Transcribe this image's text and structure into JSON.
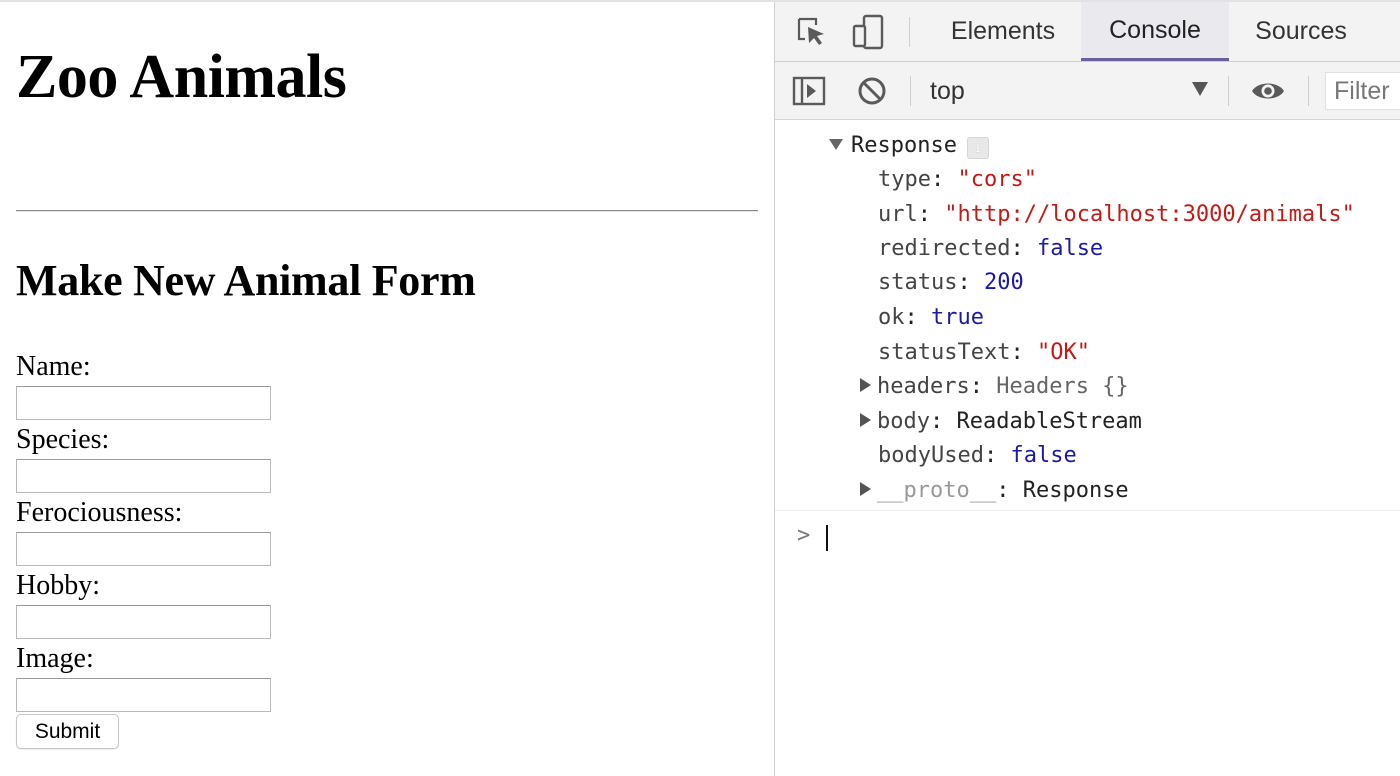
{
  "page": {
    "title": "Zoo Animals",
    "form_title": "Make New Animal Form",
    "fields": [
      {
        "label": "Name:",
        "value": ""
      },
      {
        "label": "Species:",
        "value": ""
      },
      {
        "label": "Ferociousness:",
        "value": ""
      },
      {
        "label": "Hobby:",
        "value": ""
      },
      {
        "label": "Image:",
        "value": ""
      }
    ],
    "submit_label": "Submit"
  },
  "devtools": {
    "tabs": [
      {
        "label": "Elements",
        "active": false
      },
      {
        "label": "Console",
        "active": true
      },
      {
        "label": "Sources",
        "active": false
      }
    ],
    "toolbar": {
      "context": "top",
      "filter_placeholder": "Filter"
    },
    "console": {
      "object_name": "Response",
      "info_badge": "i",
      "properties": [
        {
          "key": "type",
          "value": "\"cors\"",
          "kind": "string"
        },
        {
          "key": "url",
          "value": "\"http://localhost:3000/animals\"",
          "kind": "string"
        },
        {
          "key": "redirected",
          "value": "false",
          "kind": "boolean"
        },
        {
          "key": "status",
          "value": "200",
          "kind": "number"
        },
        {
          "key": "ok",
          "value": "true",
          "kind": "boolean"
        },
        {
          "key": "statusText",
          "value": "\"OK\"",
          "kind": "string"
        },
        {
          "key": "headers",
          "value": "Headers {}",
          "kind": "object",
          "expandable": true
        },
        {
          "key": "body",
          "value": "ReadableStream",
          "kind": "object",
          "expandable": true
        },
        {
          "key": "bodyUsed",
          "value": "false",
          "kind": "boolean"
        },
        {
          "key": "__proto__",
          "value": "Response",
          "kind": "object",
          "expandable": true
        }
      ],
      "prompt_symbol": ">"
    },
    "icons": {
      "inspect": "cursor-select-icon",
      "device": "device-toolbar-icon",
      "sidebar": "show-sidebar-icon",
      "clear": "clear-console-icon",
      "eye": "live-expression-icon"
    }
  }
}
